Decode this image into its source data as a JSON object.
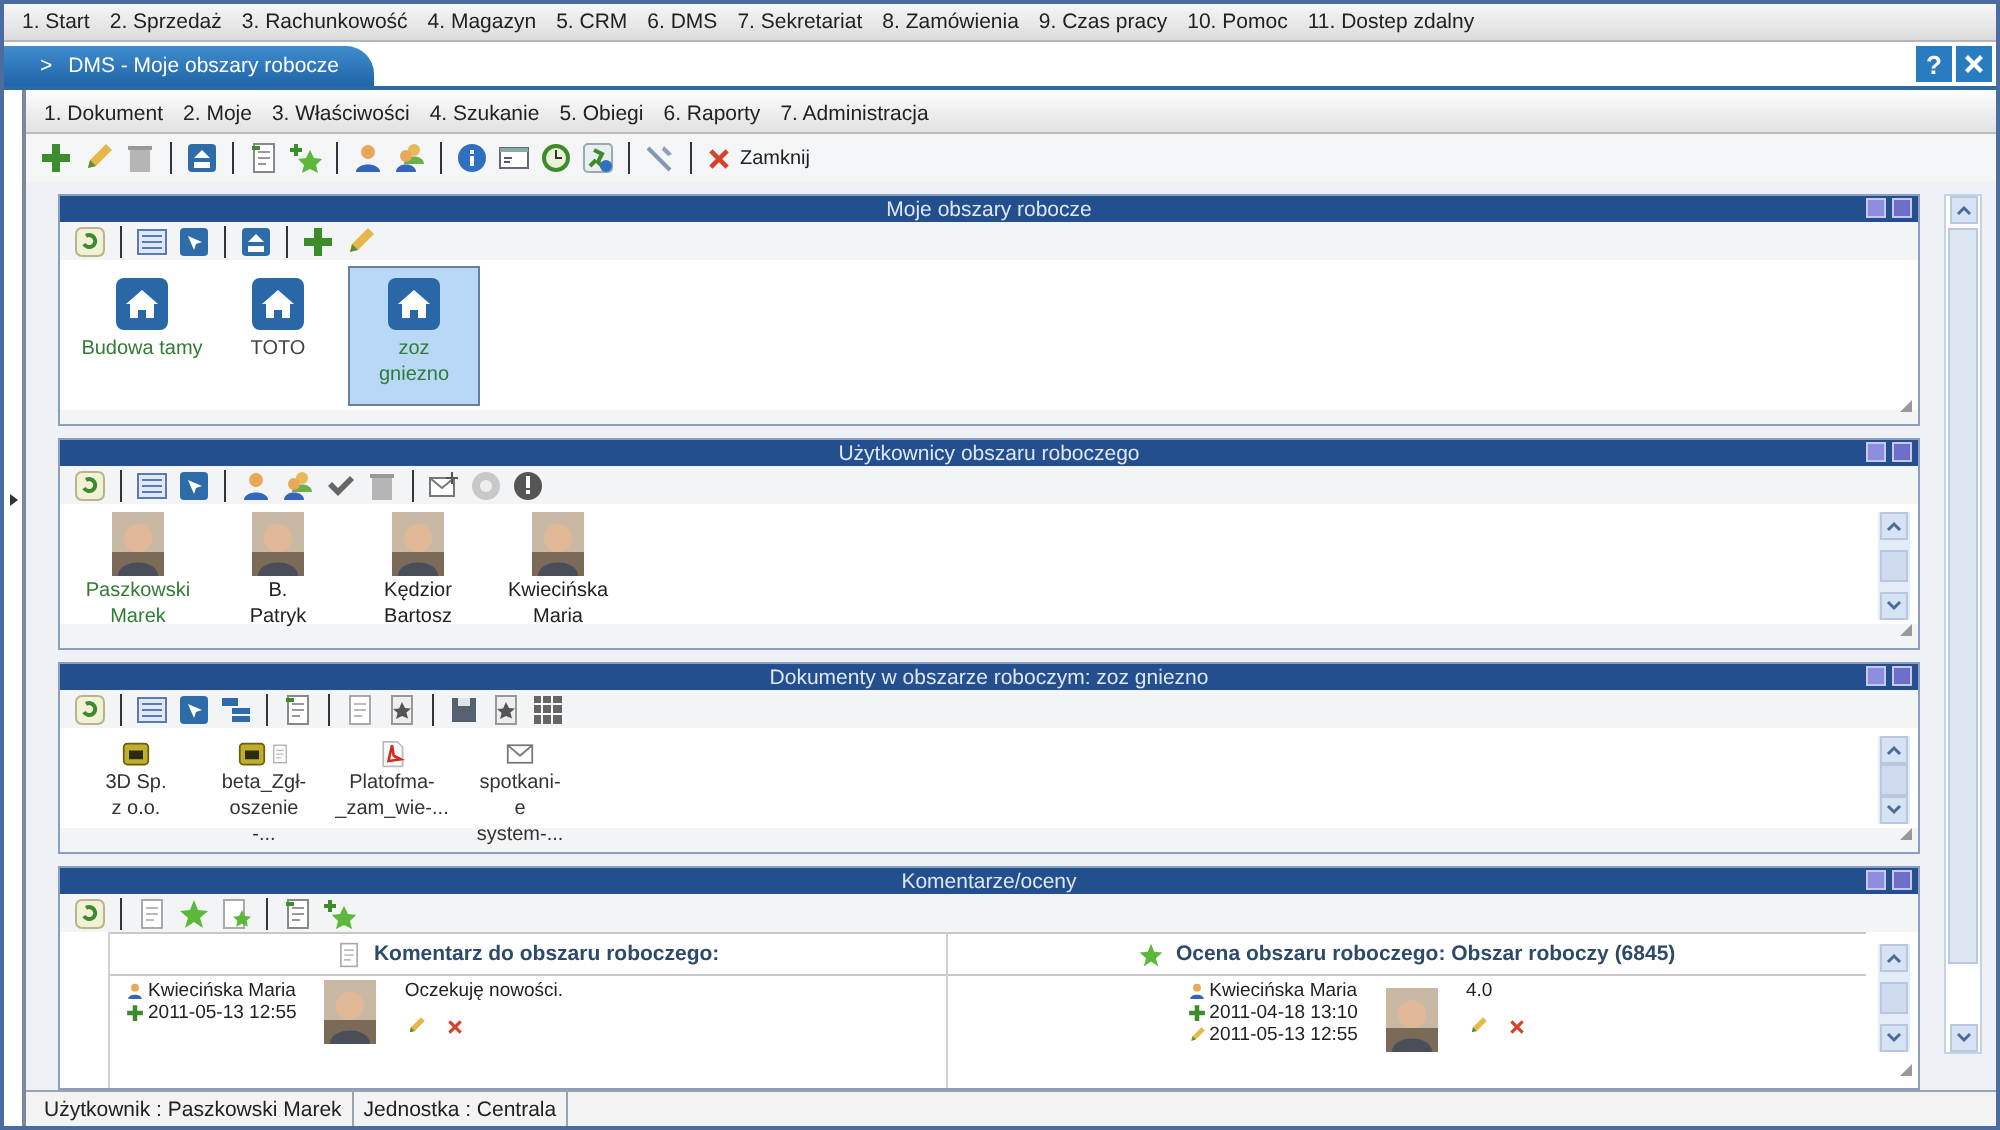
{
  "top_menu": [
    "1. Start",
    "2. Sprzedaż",
    "3. Rachunkowość",
    "4. Magazyn",
    "5. CRM",
    "6. DMS",
    "7. Sekretariat",
    "8. Zamówienia",
    "9. Czas pracy",
    "10. Pomoc",
    "11. Dostep zdalny"
  ],
  "window": {
    "tab_arrow": ">",
    "tab": "DMS - Moje obszary robocze",
    "help": "?"
  },
  "sub_menu": [
    "1. Dokument",
    "2. Moje",
    "3. Właściwości",
    "4. Szukanie",
    "5. Obiegi",
    "6. Raporty",
    "7. Administracja"
  ],
  "toolbar": {
    "close_label": "Zamknij"
  },
  "panels": [
    {
      "kind": "workspaces",
      "title": "Moje obszary robocze",
      "items": [
        {
          "name": "Budowa tamy",
          "color": "#2f7d32",
          "selected": false
        },
        {
          "name": "TOTO",
          "color": "#444444",
          "selected": false
        },
        {
          "name": "zoz gniezno",
          "color": "#2f7d32",
          "selected": true
        }
      ]
    },
    {
      "kind": "users",
      "title": "Użytkownicy obszaru roboczego",
      "items": [
        {
          "lines": [
            "Paszkowski",
            "Marek"
          ],
          "color": "#2f7d32"
        },
        {
          "lines": [
            "B.",
            "Patryk"
          ],
          "color": "#222222"
        },
        {
          "lines": [
            "Kędzior",
            "Bartosz"
          ],
          "color": "#222222"
        },
        {
          "lines": [
            "Kwiecińska",
            "Maria"
          ],
          "color": "#222222"
        }
      ]
    },
    {
      "kind": "documents",
      "title": "Dokumenty w obszarze roboczym: zoz gniezno",
      "items": [
        {
          "kind": "archive",
          "lines": [
            "3D Sp.",
            "z o.o."
          ]
        },
        {
          "kind": "archive_note",
          "lines": [
            "beta_Zgł-",
            "oszenie",
            "-..."
          ]
        },
        {
          "kind": "pdf",
          "lines": [
            "Platofma-",
            "_zam_wie-..."
          ]
        },
        {
          "kind": "mail",
          "lines": [
            "spotkani-",
            "e",
            "system-..."
          ]
        }
      ]
    },
    {
      "kind": "comments",
      "title": "Komentarze/oceny",
      "comment": {
        "title": "Komentarz do obszaru roboczego:",
        "author": "Kwiecińska Maria",
        "created": "2011-05-13 12:55",
        "text": "Oczekuję nowości."
      },
      "rating": {
        "title": "Ocena obszaru roboczego: Obszar roboczy (6845)",
        "author": "Kwiecińska Maria",
        "created": "2011-04-18 13:10",
        "modified": "2011-05-13 12:55",
        "value": "4.0"
      }
    }
  ],
  "status_bar": [
    "Użytkownik : Paszkowski Marek",
    "Jednostka : Centrala"
  ]
}
